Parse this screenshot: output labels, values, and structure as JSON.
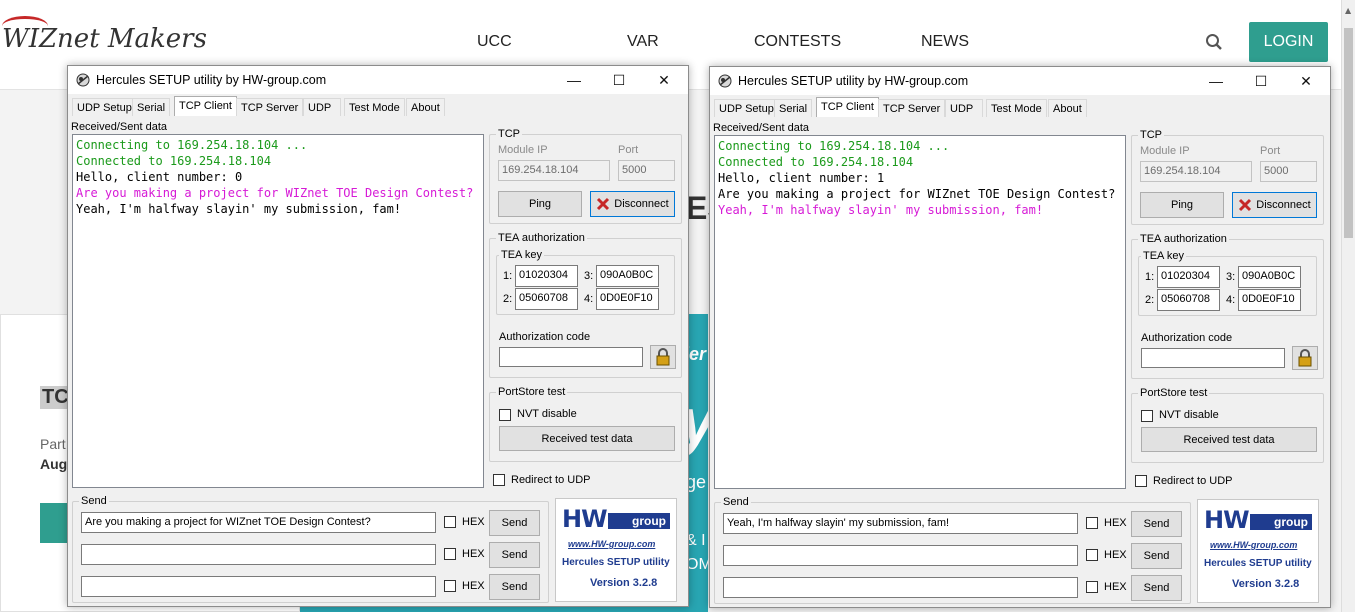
{
  "site": {
    "logo_text": "WIZnet Makers",
    "nav": [
      "UCC",
      "VAR",
      "CONTESTS",
      "NEWS"
    ],
    "login_label": "LOGIN",
    "card_title": "TC",
    "card_line2": "Part",
    "card_line3": "Aug",
    "bg_heading": "ES",
    "banner_fragments": [
      "ler",
      "y",
      "rge",
      "& I",
      "OM"
    ],
    "accent_color": "#2f9e8f"
  },
  "windows": [
    {
      "title": "Hercules SETUP utility by HW-group.com",
      "tabs": [
        "UDP Setup",
        "Serial",
        "TCP Client",
        "TCP Server",
        "UDP",
        "Test Mode",
        "About"
      ],
      "active_tab": "TCP Client",
      "received_label": "Received/Sent data",
      "terminal_lines": [
        {
          "text": "Connecting to 169.254.18.104 ...",
          "color": "green"
        },
        {
          "text": "Connected to 169.254.18.104",
          "color": "green"
        },
        {
          "text": "Hello, client number: 0",
          "color": "black"
        }
      ],
      "terminal_a": "Are you making a project for WIZnet TOE Design Contest?",
      "terminal_b": "Yeah, I'm halfway slayin' my submission, fam!",
      "terminal_a_color": "mag",
      "terminal_b_color": "black",
      "tcp_label": "TCP",
      "module_ip_label": "Module IP",
      "port_label": "Port",
      "module_ip": "169.254.18.104",
      "port": "5000",
      "ping_label": "Ping",
      "disconnect_label": "Disconnect",
      "tea_label": "TEA authorization",
      "tea_key_label": "TEA key",
      "tea_keys": [
        {
          "n": "1:",
          "v": "01020304"
        },
        {
          "n": "3:",
          "v": "090A0B0C"
        },
        {
          "n": "2:",
          "v": "05060708"
        },
        {
          "n": "4:",
          "v": "0D0E0F10"
        }
      ],
      "auth_code_label": "Authorization code",
      "portstore_label": "PortStore test",
      "nvt_label": "NVT disable",
      "received_test_label": "Received test data",
      "redirect_label": "Redirect to UDP",
      "send_label": "Send",
      "send_rows": [
        {
          "value": "Are you making a project for WIZnet TOE Design Contest?",
          "hex": "HEX",
          "button": "Send"
        },
        {
          "value": "",
          "hex": "HEX",
          "button": "Send"
        },
        {
          "value": "",
          "hex": "HEX",
          "button": "Send"
        }
      ],
      "hw_big": "HW",
      "hw_group": "group",
      "hw_url": "www.HW-group.com",
      "hw_util": "Hercules SETUP utility",
      "hw_version": "Version  3.2.8"
    },
    {
      "title": "Hercules SETUP utility by HW-group.com",
      "tabs": [
        "UDP Setup",
        "Serial",
        "TCP Client",
        "TCP Server",
        "UDP",
        "Test Mode",
        "About"
      ],
      "active_tab": "TCP Client",
      "received_label": "Received/Sent data",
      "terminal_lines": [
        {
          "text": "Connecting to 169.254.18.104 ...",
          "color": "green"
        },
        {
          "text": "Connected to 169.254.18.104",
          "color": "green"
        },
        {
          "text": "Hello, client number: 1",
          "color": "black"
        }
      ],
      "terminal_a": "Are you making a project for WIZnet TOE Design Contest?",
      "terminal_b": "Yeah, I'm halfway slayin' my submission, fam!",
      "terminal_a_color": "black",
      "terminal_b_color": "mag",
      "tcp_label": "TCP",
      "module_ip_label": "Module IP",
      "port_label": "Port",
      "module_ip": "169.254.18.104",
      "port": "5000",
      "ping_label": "Ping",
      "disconnect_label": "Disconnect",
      "tea_label": "TEA authorization",
      "tea_key_label": "TEA key",
      "tea_keys": [
        {
          "n": "1:",
          "v": "01020304"
        },
        {
          "n": "3:",
          "v": "090A0B0C"
        },
        {
          "n": "2:",
          "v": "05060708"
        },
        {
          "n": "4:",
          "v": "0D0E0F10"
        }
      ],
      "auth_code_label": "Authorization code",
      "portstore_label": "PortStore test",
      "nvt_label": "NVT disable",
      "received_test_label": "Received test data",
      "redirect_label": "Redirect to UDP",
      "send_label": "Send",
      "send_rows": [
        {
          "value": "Yeah, I'm halfway slayin' my submission, fam!",
          "hex": "HEX",
          "button": "Send"
        },
        {
          "value": "",
          "hex": "HEX",
          "button": "Send"
        },
        {
          "value": "",
          "hex": "HEX",
          "button": "Send"
        }
      ],
      "hw_big": "HW",
      "hw_group": "group",
      "hw_url": "www.HW-group.com",
      "hw_util": "Hercules SETUP utility",
      "hw_version": "Version  3.2.8"
    }
  ]
}
